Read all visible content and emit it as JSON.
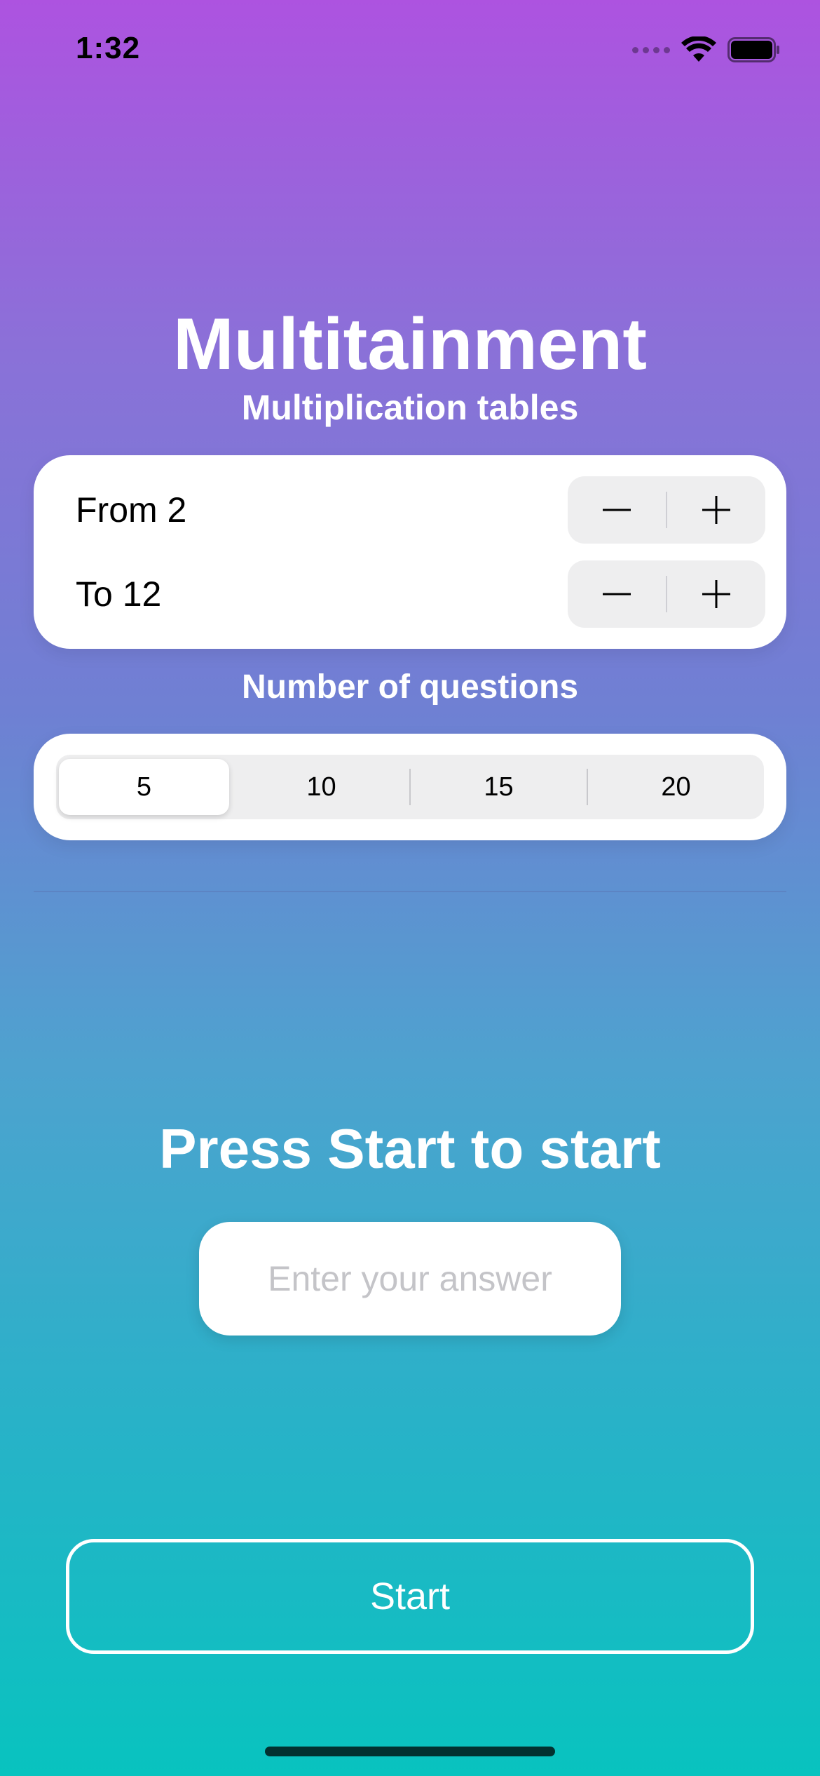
{
  "status_bar": {
    "time": "1:32",
    "icons": [
      "signal-icon",
      "wifi-icon",
      "battery-icon"
    ]
  },
  "header": {
    "title": "Multitainment",
    "subtitle": "Multiplication tables"
  },
  "range": {
    "from_label": "From 2",
    "to_label": "To 12",
    "stepper_icons": [
      "minus-icon",
      "plus-icon"
    ]
  },
  "questions": {
    "label": "Number of questions",
    "options": [
      "5",
      "10",
      "15",
      "20"
    ],
    "selected": "5"
  },
  "quiz": {
    "prompt": "Press Start to start",
    "answer_placeholder": "Enter your answer",
    "answer_value": ""
  },
  "actions": {
    "start_label": "Start"
  },
  "colors": {
    "gradient_top": "#ad53e0",
    "gradient_bottom": "#08c3bf",
    "card": "#ffffff",
    "control_bg": "#eeeeef"
  }
}
